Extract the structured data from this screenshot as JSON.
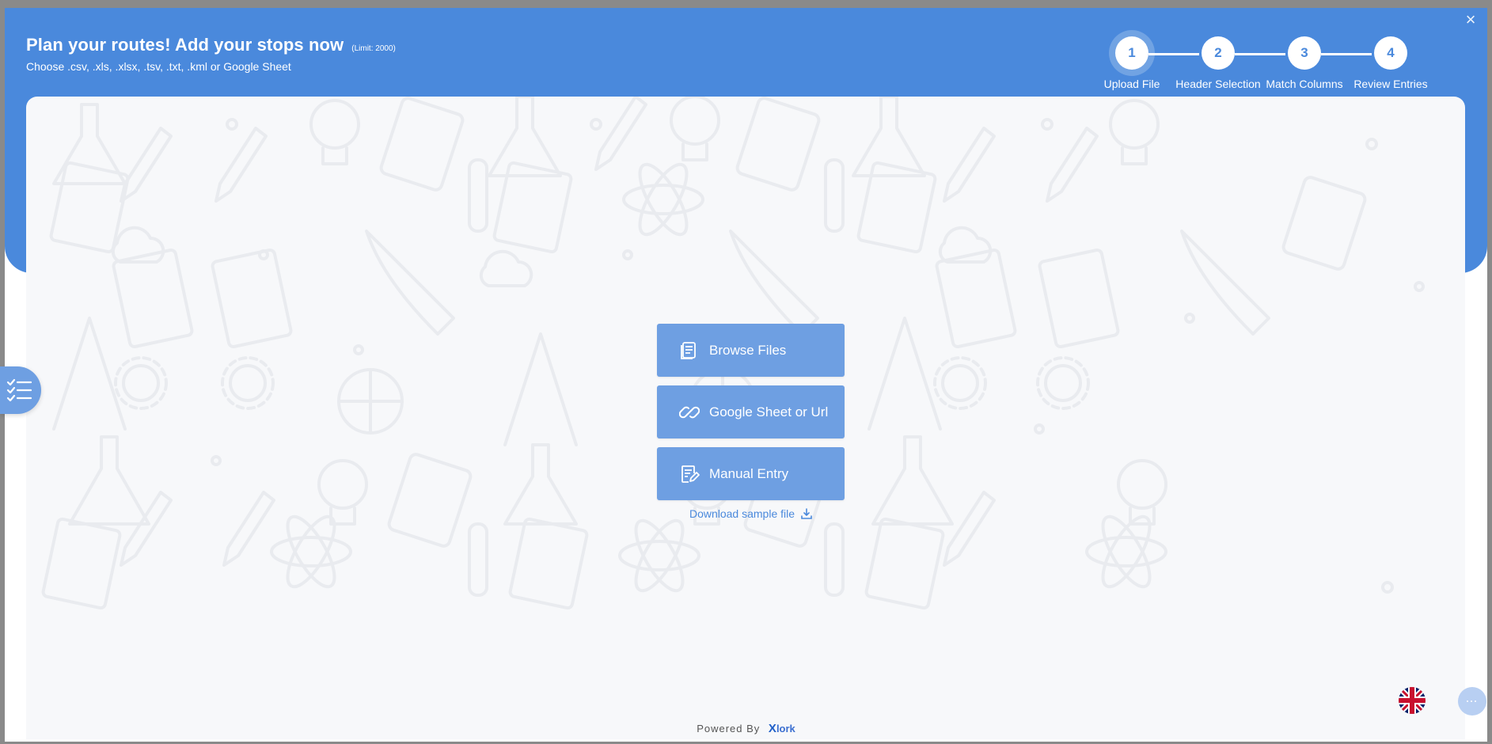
{
  "header": {
    "title": "Plan your routes! Add your stops now",
    "limit": "(Limit: 2000)",
    "subtitle": "Choose .csv, .xls, .xlsx, .tsv, .txt, .kml or Google Sheet",
    "close_icon": "×"
  },
  "steps": [
    {
      "number": "1",
      "label": "Upload File",
      "active": true
    },
    {
      "number": "2",
      "label": "Header Selection",
      "active": false
    },
    {
      "number": "3",
      "label": "Match Columns",
      "active": false
    },
    {
      "number": "4",
      "label": "Review Entries",
      "active": false
    }
  ],
  "actions": {
    "browse": "Browse Files",
    "google": "Google Sheet or Url",
    "manual": "Manual Entry",
    "download": "Download sample file"
  },
  "footer": {
    "powered_by": "Powered By",
    "brand_x": "X",
    "brand": "lork"
  },
  "colors": {
    "primary": "#4a89dc",
    "button": "#6e9fe2",
    "content_bg": "#f7f8fa"
  }
}
